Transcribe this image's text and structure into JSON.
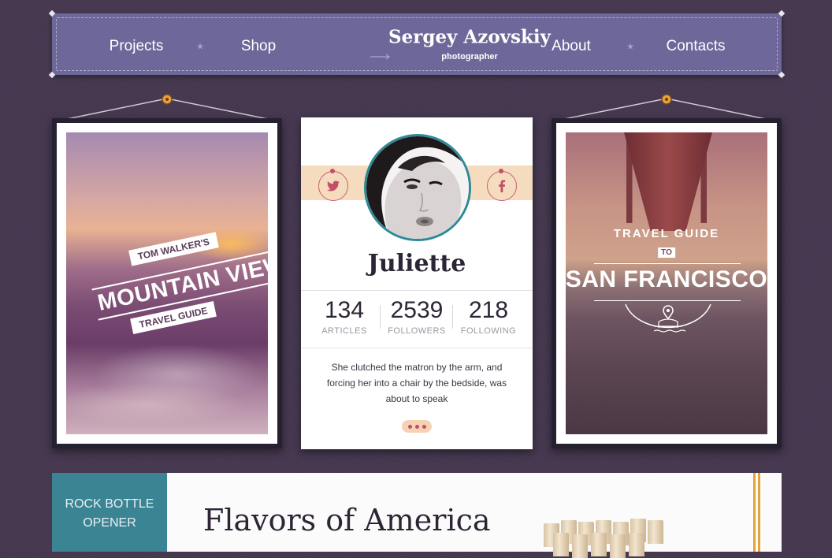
{
  "nav": {
    "left_items": [
      "Projects",
      "Shop"
    ],
    "right_items": [
      "About",
      "Contacts"
    ],
    "brand_name": "Sergey Azovskiy",
    "brand_subtitle": "photographer",
    "star_glyph": "★"
  },
  "posters": {
    "left": {
      "line1": "TOM WALKER'S",
      "line2": "MOUNTAIN VIEW",
      "line3": "TRAVEL GUIDE"
    },
    "right": {
      "arc": "TRAVEL GUIDE",
      "to": "TO",
      "title": "SAN FRANCISCO"
    }
  },
  "profile": {
    "name": "Juliette",
    "stats": [
      {
        "value": "134",
        "label": "ARTICLES"
      },
      {
        "value": "2539",
        "label": "FOLLOWERS"
      },
      {
        "value": "218",
        "label": "FOLLOWING"
      }
    ],
    "bio": "She clutched the matron by the arm, and forcing her into a chair by the bedside, was about to speak",
    "social": {
      "left": "twitter-icon",
      "right": "facebook-icon"
    }
  },
  "bottom": {
    "tag_line1": "ROCK BOTTLE",
    "tag_line2": "OPENER",
    "title": "Flavors of America"
  },
  "colors": {
    "background": "#453850",
    "nav": "#6e6799",
    "accent_pink": "#c24f67",
    "accent_teal": "#2f8a98",
    "band": "#f6dcbf",
    "pin": "#e8a33d"
  }
}
